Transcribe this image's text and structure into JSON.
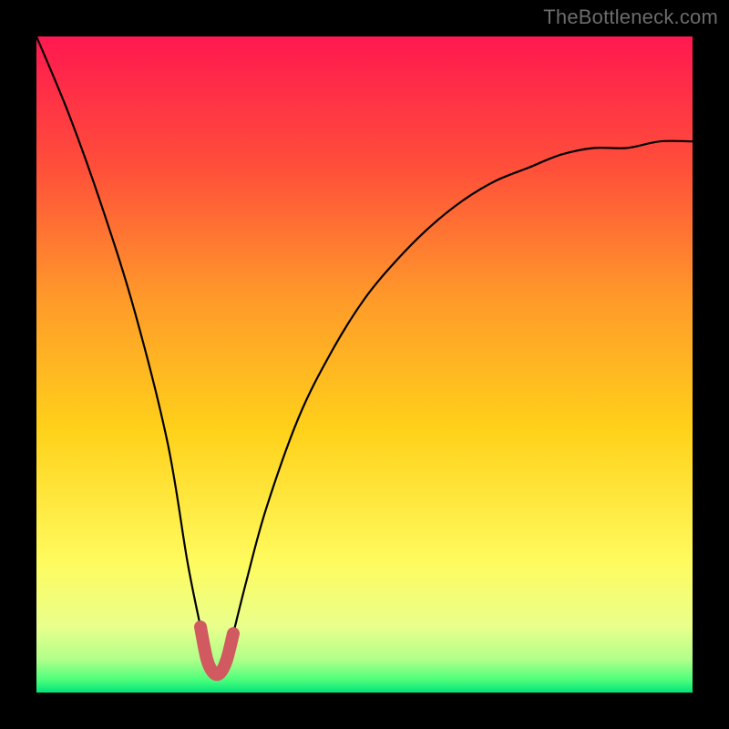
{
  "watermark": "TheBottleneck.com",
  "colors": {
    "frame": "#000000",
    "curve_stroke": "#000000",
    "highlight_stroke": "#d05a5f",
    "gradient_stops": [
      {
        "offset": 0.0,
        "color": "#ff1850"
      },
      {
        "offset": 0.2,
        "color": "#ff4f3a"
      },
      {
        "offset": 0.4,
        "color": "#ff9a2a"
      },
      {
        "offset": 0.6,
        "color": "#ffd11a"
      },
      {
        "offset": 0.8,
        "color": "#fffb5e"
      },
      {
        "offset": 0.9,
        "color": "#e9ff8c"
      },
      {
        "offset": 0.95,
        "color": "#b0ff8a"
      },
      {
        "offset": 0.98,
        "color": "#4fff7c"
      },
      {
        "offset": 1.0,
        "color": "#00e47a"
      }
    ]
  },
  "chart_data": {
    "type": "line",
    "title": "",
    "xlabel": "",
    "ylabel": "",
    "xlim": [
      0,
      100
    ],
    "ylim": [
      0,
      100
    ],
    "notes": "V-shaped bottleneck curve; minimum near x≈27%. Background is a vertical heat gradient (red high, green low). Rounded trough highlighted in salmon.",
    "series": [
      {
        "name": "bottleneck-curve",
        "x": [
          0,
          5,
          10,
          15,
          20,
          23,
          25,
          26,
          27,
          28,
          29,
          30,
          32,
          35,
          40,
          45,
          50,
          55,
          60,
          65,
          70,
          75,
          80,
          85,
          90,
          95,
          100
        ],
        "y": [
          100,
          88,
          74,
          58,
          38,
          20,
          10,
          5,
          3,
          3,
          5,
          9,
          17,
          28,
          42,
          52,
          60,
          66,
          71,
          75,
          78,
          80,
          82,
          83,
          83,
          84,
          84
        ]
      }
    ],
    "highlight": {
      "x_range": [
        25,
        30
      ],
      "y_range": [
        3,
        10
      ]
    },
    "optimal_x": 27
  }
}
